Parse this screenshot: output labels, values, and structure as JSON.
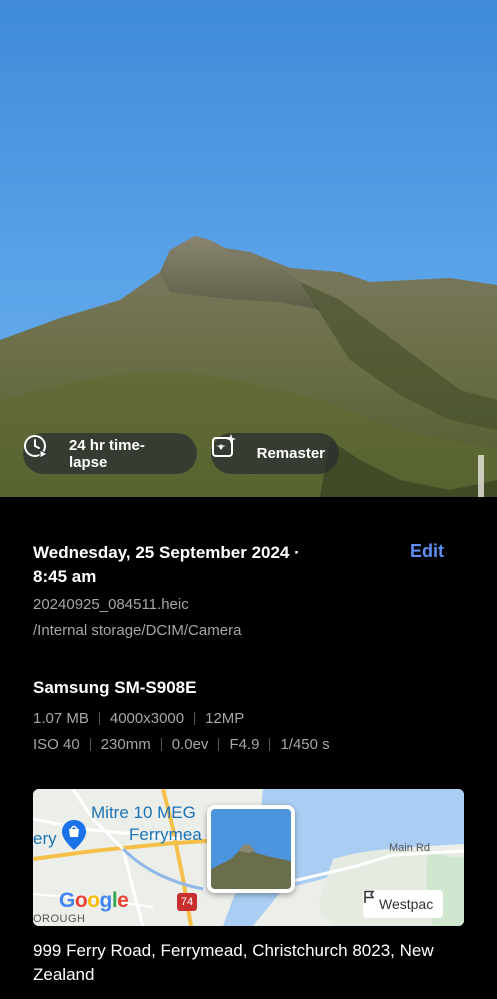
{
  "photo": {
    "time_lapse_label": "24 hr time-lapse",
    "remaster_label": "Remaster",
    "time_lapse_icon": "clock-play-icon",
    "remaster_icon": "sparkle-image-icon"
  },
  "details": {
    "date_line1": "Wednesday, 25 September 2024 ·",
    "date_line2": "8:45 am",
    "edit_label": "Edit",
    "filename": "20240925_084511.heic",
    "path": "/Internal storage/DCIM/Camera",
    "device": "Samsung SM-S908E",
    "file_size": "1.07 MB",
    "resolution": "4000x3000",
    "megapixels": "12MP",
    "iso": "ISO 40",
    "focal_length": "230mm",
    "exposure": "0.0ev",
    "aperture": "F4.9",
    "shutter": "1/450 s"
  },
  "map": {
    "place_label_line1": "Mitre 10 MEG",
    "place_label_line2": "Ferrymea",
    "left_label": "ery",
    "road_label": "Main Rd",
    "route_number": "74",
    "area_label": "OROUGH",
    "google_letters": [
      "G",
      "o",
      "o",
      "g",
      "l",
      "e"
    ],
    "google_colors": [
      "#4285f4",
      "#ea4335",
      "#fbbc05",
      "#4285f4",
      "#34a853",
      "#ea4335"
    ],
    "westpac_label": "Westpac",
    "westpac_icon": "flag-icon"
  },
  "address": "999 Ferry Road, Ferrymead, Christchurch 8023, New Zealand",
  "colors": {
    "accent": "#5f8ff2",
    "secondary_text": "#a6a6a6"
  }
}
